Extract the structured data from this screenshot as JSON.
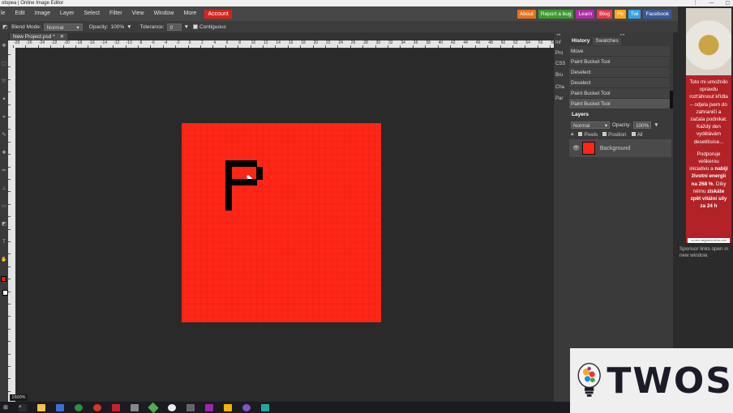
{
  "window": {
    "title": "otopea | Online Image Editor",
    "controls": [
      "⋮",
      "—",
      "▢"
    ]
  },
  "menu": {
    "items": [
      "le",
      "Edit",
      "Image",
      "Layer",
      "Select",
      "Filter",
      "View",
      "Window",
      "More"
    ],
    "account": "Account"
  },
  "ext_buttons": [
    {
      "label": "About",
      "color": "#e8711b"
    },
    {
      "label": "Report a bug",
      "color": "#3c9a2f"
    },
    {
      "label": "Learn",
      "color": "#b02aa8"
    },
    {
      "label": "Blog",
      "color": "#e33a4a"
    },
    {
      "label": "Fb",
      "color": "#f6a81a"
    },
    {
      "label": "Twi",
      "color": "#35a1e8"
    },
    {
      "label": "Facebook",
      "color": "#3b5998"
    }
  ],
  "options": {
    "blend_label": "Blend Mode:",
    "blend_value": "Normal",
    "opacity_label": "Opacity:",
    "opacity_value": "100%",
    "tolerance_label": "Tolerance:",
    "tolerance_value": "0",
    "contiguous": "Contiguous"
  },
  "document": {
    "tab_label": "New Project.psd *",
    "close": "✕",
    "zoom": "1600%"
  },
  "ruler": {
    "h_labels": [
      "-28",
      "-26",
      "-24",
      "-22",
      "-20",
      "-18",
      "-16",
      "-14",
      "-12",
      "-10",
      "-8",
      "-6",
      "-4",
      "-2",
      "0",
      "2",
      "4",
      "6",
      "8",
      "10",
      "12",
      "14",
      "16",
      "18",
      "20",
      "22",
      "24",
      "26",
      "28",
      "30",
      "32",
      "34",
      "36",
      "38",
      "40",
      "42",
      "44",
      "46",
      "48",
      "50",
      "52",
      "54",
      "56",
      "58"
    ]
  },
  "mini_panels": [
    "Inf",
    "Pro",
    "CSS",
    "Bru",
    "Cha",
    "Par"
  ],
  "panel": {
    "tabs": [
      "History",
      "Swatches"
    ],
    "history": [
      "Move",
      "Paint Bucket Tool",
      "Deselect",
      "Deselect",
      "Paint Bucket Tool",
      "Paint Bucket Tool"
    ],
    "layers_title": "Layers",
    "layer_blend": "Normal",
    "layer_opacity_label": "Opacity:",
    "layer_opacity": "100%",
    "lock": [
      "Pixels",
      "Position",
      "All"
    ],
    "layer_name": "Background"
  },
  "ad": {
    "line1": "Toto mi umožnilo opravdu rozťáhnout křídla – odjela jsem do zahraničí a začala podnikat. Každý den vydělávám desetitisíce...",
    "line2a": "Podporuje veškerou iniciativu a ",
    "line2b": "nabíjí životní energii na 268 %",
    "line2c": ". Díky němu ",
    "line2d": "získáte zpět vitální síly za 24 h",
    "footer": "cs.new.megatonicdetox.com",
    "sponsor_note": "Sponsor links open in new window."
  },
  "watermark": "TWOS",
  "colors": {
    "canvas": "#ff2616",
    "foreground": "#e01e0e",
    "background": "#ffffff",
    "accent": "#d8241b"
  }
}
